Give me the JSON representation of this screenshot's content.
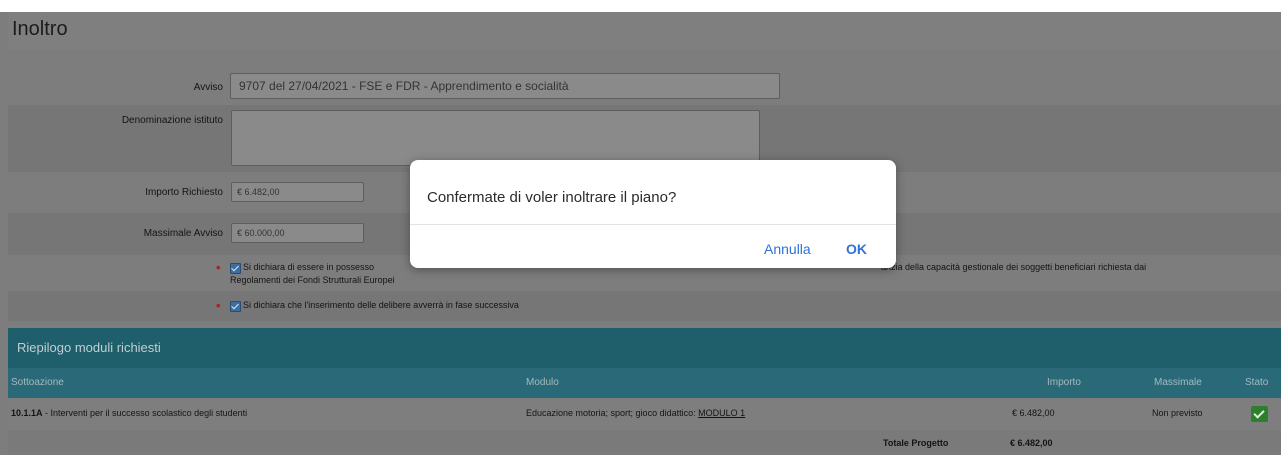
{
  "header": {
    "title": "Inoltro"
  },
  "form": {
    "avviso_label": "Avviso",
    "avviso_value": "9707 del 27/04/2021 - FSE e FDR - Apprendimento e socialità",
    "denominazione_label": "Denominazione istituto",
    "denominazione_value": "",
    "importo_label": "Importo Richiesto",
    "importo_value": "€ 6.482,00",
    "massimale_label": "Massimale Avviso",
    "massimale_value": "€ 60.000,00",
    "declaration_1_left": "Si dichiara di essere in possesso",
    "declaration_1_right": "anzia della capacità gestionale dei soggetti beneficiari richiesta dai",
    "declaration_1_line2": "Regolamenti dei Fondi Strutturali Europei",
    "declaration_2": "Si dichiara che l'inserimento delle delibere avverrà in fase successiva",
    "required_mark": "•"
  },
  "summary": {
    "title": "Riepilogo moduli richiesti",
    "columns": [
      "Sottoazione",
      "Modulo",
      "Importo",
      "Massimale",
      "Stato"
    ],
    "rows": [
      {
        "sottoazione_code": "10.1.1A",
        "sottoazione_text": " - Interventi per il successo scolastico degli studenti",
        "modulo_text": "Educazione motoria; sport; gioco didattico: ",
        "modulo_link": "MODULO 1",
        "importo": "€ 6.482,00",
        "massimale": "Non previsto",
        "stato": "check"
      }
    ],
    "total_label": "Totale Progetto",
    "total_value": "€ 6.482,00"
  },
  "modal": {
    "message": "Confermate di voler inoltrare il piano?",
    "cancel_label": "Annulla",
    "ok_label": "OK"
  },
  "colors": {
    "overlay": "#7d7d7d",
    "table_header": "#1f5e6b",
    "modal_button": "#2f72d8",
    "status_ok": "#2f7d2f"
  }
}
